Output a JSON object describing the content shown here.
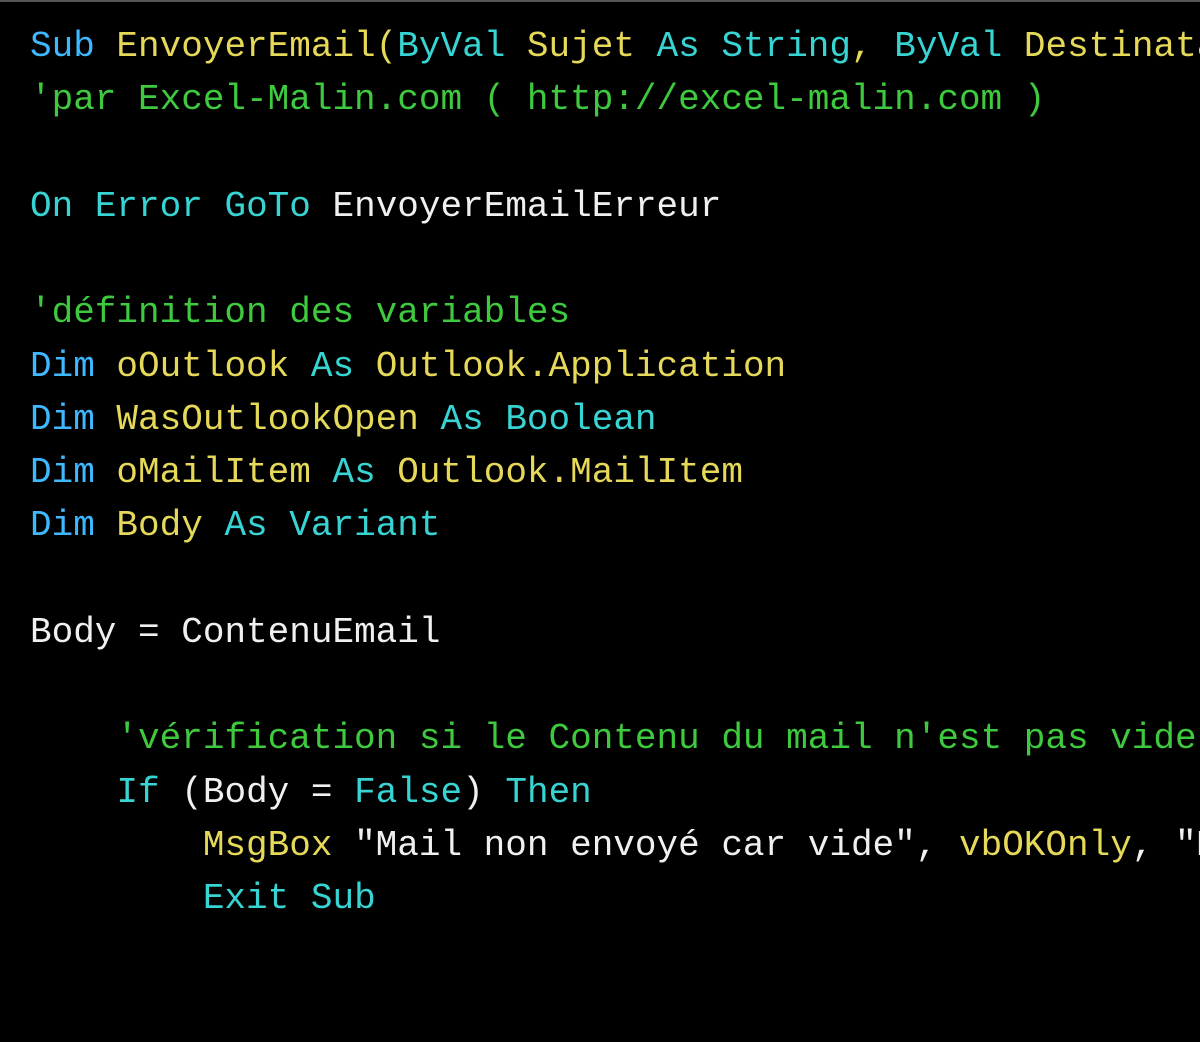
{
  "code": {
    "line1": {
      "sub": "Sub",
      "fn_name": "EnvoyerEmail",
      "paren_open": "(",
      "byval1": "ByVal",
      "param1": "Sujet",
      "as1": "As",
      "type1": "String",
      "comma": ",",
      "byval2": "ByVal",
      "param2": "Destinataire"
    },
    "line2": {
      "comment": "'par Excel-Malin.com ( http://excel-malin.com )"
    },
    "line4": {
      "on": "On",
      "error": "Error",
      "goto": "GoTo",
      "label": "EnvoyerEmailErreur"
    },
    "line6": {
      "comment": "'définition des variables"
    },
    "line7": {
      "dim": "Dim",
      "var": "oOutlook",
      "as": "As",
      "type": "Outlook.Application"
    },
    "line8": {
      "dim": "Dim",
      "var": "WasOutlookOpen",
      "as": "As",
      "type": "Boolean"
    },
    "line9": {
      "dim": "Dim",
      "var": "oMailItem",
      "as": "As",
      "type": "Outlook.MailItem"
    },
    "line10": {
      "dim": "Dim",
      "var": "Body",
      "as": "As",
      "type": "Variant"
    },
    "line12": {
      "var": "Body",
      "eq": "=",
      "val": "ContenuEmail"
    },
    "line14": {
      "comment": "'vérification si le Contenu du mail n'est pas vide. Si oui, e"
    },
    "line15": {
      "if": "If",
      "paren_open": "(",
      "var": "Body",
      "eq": "=",
      "false": "False",
      "paren_close": ")",
      "then": "Then"
    },
    "line16": {
      "msgbox": "MsgBox",
      "str1": "\"Mail non envoyé car vide\"",
      "comma1": ",",
      "const": "vbOKOnly",
      "comma2": ",",
      "str2": "\"Mess"
    },
    "line17": {
      "exit": "Exit",
      "sub": "Sub"
    }
  }
}
